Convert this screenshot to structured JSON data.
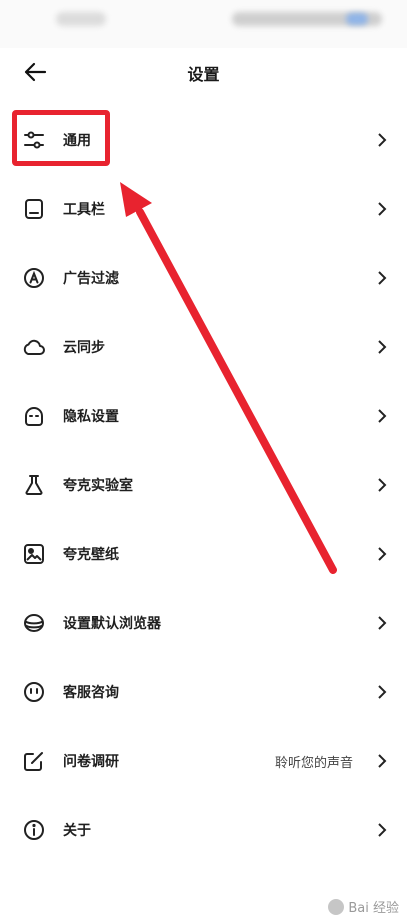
{
  "header": {
    "title": "设置"
  },
  "settings": [
    {
      "label": "通用",
      "icon": "sliders-icon"
    },
    {
      "label": "工具栏",
      "icon": "toolbar-icon"
    },
    {
      "label": "广告过滤",
      "icon": "ad-filter-icon"
    },
    {
      "label": "云同步",
      "icon": "cloud-icon"
    },
    {
      "label": "隐私设置",
      "icon": "privacy-icon"
    },
    {
      "label": "夸克实验室",
      "icon": "flask-icon"
    },
    {
      "label": "夸克壁纸",
      "icon": "image-icon"
    },
    {
      "label": "设置默认浏览器",
      "icon": "database-icon"
    },
    {
      "label": "客服咨询",
      "icon": "service-icon"
    },
    {
      "label": "问卷调研",
      "icon": "edit-icon",
      "hint": "聆听您的声音"
    },
    {
      "label": "关于",
      "icon": "info-icon"
    }
  ],
  "annotation": {
    "color": "#e8232f"
  },
  "watermark": {
    "text": "Bai 经验"
  }
}
